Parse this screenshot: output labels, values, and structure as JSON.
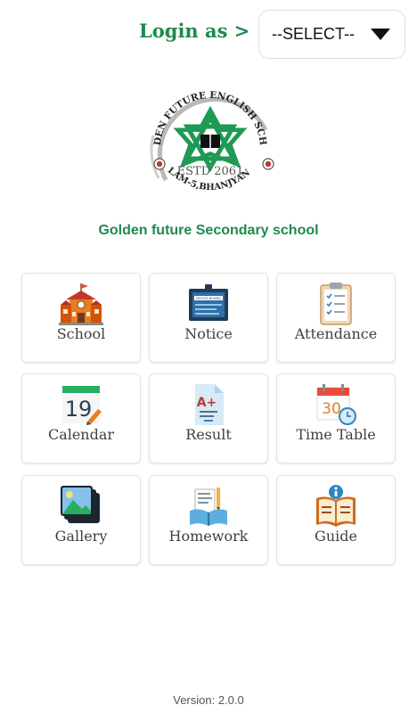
{
  "header": {
    "login_label": "Login as >",
    "select_value": "--SELECT--",
    "brand_color": "#1f8a4c"
  },
  "logo": {
    "ring_text": "GOLDEN FUTURE ENGLISH SCHOOL",
    "estd_text": "ESTD 2061",
    "place_text": "ILAM-5,BHANJYANG"
  },
  "school_name": "Golden future Secondary school",
  "menu": [
    {
      "label": "School",
      "icon": "school-building-icon"
    },
    {
      "label": "Notice",
      "icon": "notice-board-icon"
    },
    {
      "label": "Attendance",
      "icon": "clipboard-checklist-icon"
    },
    {
      "label": "Calendar",
      "icon": "calendar-icon"
    },
    {
      "label": "Result",
      "icon": "result-document-icon"
    },
    {
      "label": "Time Table",
      "icon": "timetable-icon"
    },
    {
      "label": "Gallery",
      "icon": "gallery-icon"
    },
    {
      "label": "Homework",
      "icon": "homework-books-icon"
    },
    {
      "label": "Guide",
      "icon": "guide-book-icon"
    }
  ],
  "icon_text": {
    "notice_board": "NOTICE BOARD",
    "calendar_day": "19",
    "result_grade": "A+",
    "timetable_day": "30"
  },
  "footer": {
    "version": "Version: 2.0.0"
  }
}
